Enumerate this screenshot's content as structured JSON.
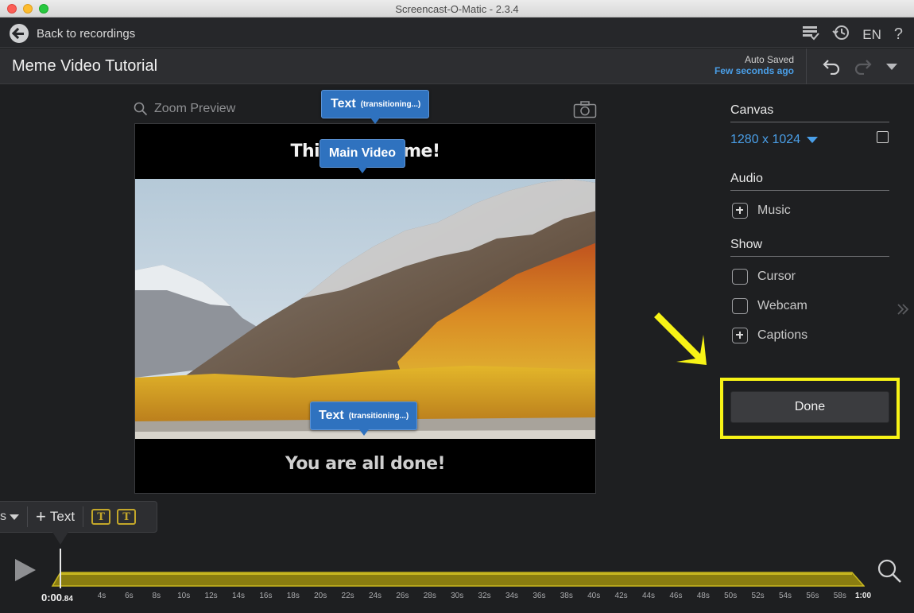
{
  "window": {
    "title": "Screencast-O-Matic - 2.3.4"
  },
  "topnav": {
    "back_label": "Back to recordings",
    "lang": "EN",
    "help": "?"
  },
  "header": {
    "title": "Meme Video Tutorial",
    "saved_label": "Auto Saved",
    "saved_time": "Few seconds ago"
  },
  "preview": {
    "zoom_label": "Zoom Preview",
    "meme_top_text": "This is a meme!",
    "meme_bottom_text": "You are all done!",
    "tags": [
      {
        "main": "Text",
        "sub": "(transitioning...)"
      },
      {
        "main": "Main Video"
      },
      {
        "main": "Text",
        "sub": "(transitioning...)"
      }
    ]
  },
  "panel": {
    "canvas_title": "Canvas",
    "canvas_size": "1280 x 1024",
    "audio_title": "Audio",
    "music_label": "Music",
    "show_title": "Show",
    "cursor_label": "Cursor",
    "webcam_label": "Webcam",
    "captions_label": "Captions",
    "done_label": "Done"
  },
  "toolbar": {
    "s_label": "s",
    "add_text_label": "Text",
    "fmt1": "T",
    "fmt2": "T"
  },
  "timeline": {
    "current_time": "0:00",
    "current_frac": ".84",
    "ticks": [
      "4s",
      "6s",
      "8s",
      "10s",
      "12s",
      "14s",
      "16s",
      "18s",
      "20s",
      "22s",
      "24s",
      "26s",
      "28s",
      "30s",
      "32s",
      "34s",
      "36s",
      "38s",
      "40s",
      "42s",
      "44s",
      "46s",
      "48s",
      "50s",
      "52s",
      "54s",
      "56s",
      "58s"
    ],
    "end_time": "1:00"
  },
  "colors": {
    "accent_blue": "#4a9fe8",
    "tag_blue": "#2f72bf",
    "highlight_yellow": "#f7f316",
    "track_yellow": "#c9b820"
  }
}
